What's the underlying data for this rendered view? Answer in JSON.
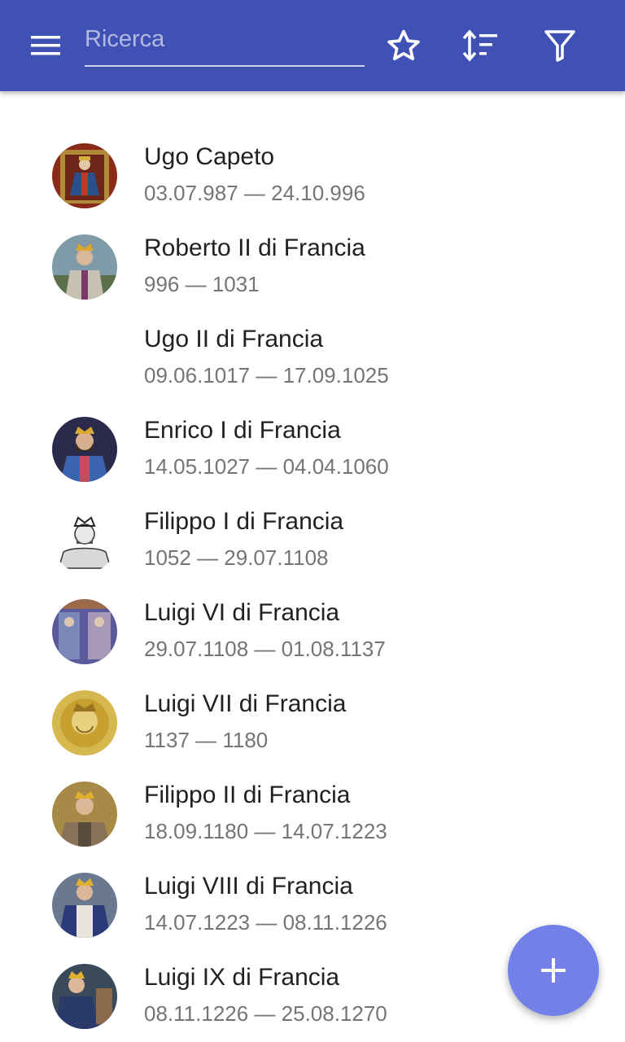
{
  "toolbar": {
    "search_placeholder": "Ricerca",
    "search_value": "",
    "icons": [
      "menu-icon",
      "star-outline-icon",
      "sort-icon",
      "filter-icon"
    ],
    "color": "#3f51b5"
  },
  "rulers": [
    {
      "name": "Ugo Capeto",
      "dates": "03.07.987 — 24.10.996",
      "has_portrait": true
    },
    {
      "name": "Roberto II di Francia",
      "dates": "996 — 1031",
      "has_portrait": true
    },
    {
      "name": "Ugo II di Francia",
      "dates": "09.06.1017 — 17.09.1025",
      "has_portrait": false
    },
    {
      "name": "Enrico I di Francia",
      "dates": "14.05.1027 — 04.04.1060",
      "has_portrait": true
    },
    {
      "name": "Filippo I di Francia",
      "dates": "1052 — 29.07.1108",
      "has_portrait": true
    },
    {
      "name": "Luigi VI di Francia",
      "dates": "29.07.1108 — 01.08.1137",
      "has_portrait": true
    },
    {
      "name": "Luigi VII di Francia",
      "dates": "1137 — 1180",
      "has_portrait": true
    },
    {
      "name": "Filippo II di Francia",
      "dates": "18.09.1180 — 14.07.1223",
      "has_portrait": true
    },
    {
      "name": "Luigi VIII di Francia",
      "dates": "14.07.1223 — 08.11.1226",
      "has_portrait": true
    },
    {
      "name": "Luigi IX di Francia",
      "dates": "08.11.1226 — 25.08.1270",
      "has_portrait": true
    }
  ],
  "fab": {
    "icon": "plus-icon",
    "color": "#7280e8"
  }
}
